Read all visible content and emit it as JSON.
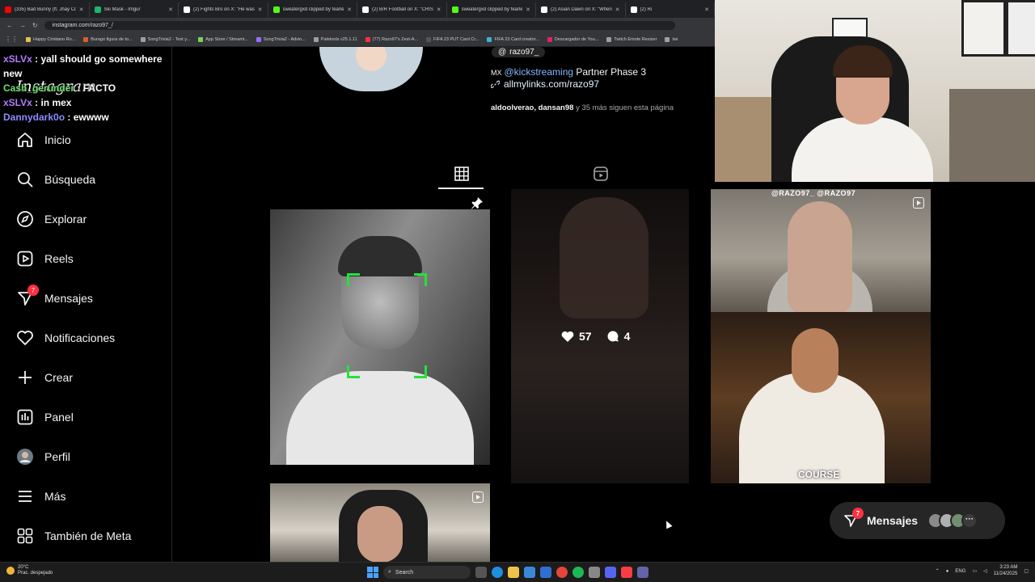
{
  "browser": {
    "tabs": [
      {
        "label": "(335) Bad Bunny (ft. Jhay Corte",
        "color": "#ff0000"
      },
      {
        "label": "Ski Mask - Imgur",
        "color": "#1bb76e"
      },
      {
        "label": "(2) Fights Bro on X: \"He was fe",
        "color": "#ffffff"
      },
      {
        "label": "sweatergxd clipped by fearless",
        "color": "#53fc18"
      },
      {
        "label": "(2) B/R Football on X: \"CRISTIA",
        "color": "#ffffff"
      },
      {
        "label": "sweatergxd clipped by fearless",
        "color": "#53fc18"
      },
      {
        "label": "(2) Asian Dawn on X: \"When yo",
        "color": "#ffffff"
      },
      {
        "label": "(2) Ri",
        "color": "#ffffff"
      }
    ],
    "url": "instagram.com/razo97_/",
    "bookmarks": [
      {
        "label": "Happy Cristiano Ro...",
        "color": "#e8c24a"
      },
      {
        "label": "Burago figura de to...",
        "color": "#e05a2b"
      },
      {
        "label": "SongTrivia2 - Test y...",
        "color": "#9aa0a6"
      },
      {
        "label": "App Store / Streami...",
        "color": "#7ad35a"
      },
      {
        "label": "SongTrivia2 - Advin...",
        "color": "#9b6bff"
      },
      {
        "label": "Paletools v25.1.11",
        "color": "#9aa0a6"
      },
      {
        "label": "(77) Razo97's Zest-A...",
        "color": "#ff3040"
      },
      {
        "label": "FIFA 23 PUT Card Cr...",
        "color": "#555"
      },
      {
        "label": "FIFA 23 Card creator...",
        "color": "#3fb0d9"
      },
      {
        "label": "Descargador de You...",
        "color": "#e0245e"
      },
      {
        "label": "Twitch Emote Resizer",
        "color": "#9aa0a6"
      },
      {
        "label": "twi",
        "color": "#9aa0a6"
      }
    ]
  },
  "chat": [
    {
      "user": "xSLVx",
      "text": " : yall should go somewhere new",
      "cls": "u1"
    },
    {
      "user": "Cash_gerunder",
      "text": " : FACTO",
      "cls": "u2"
    },
    {
      "user": "xSLVx",
      "text": " : in mex",
      "cls": "u1"
    },
    {
      "user": "Dannydark0o",
      "text": " : ewwww",
      "cls": "u3"
    }
  ],
  "sidebar": {
    "logo": "Instagram",
    "items": [
      {
        "label": "Inicio",
        "icon": "home-icon"
      },
      {
        "label": "Búsqueda",
        "icon": "search-icon"
      },
      {
        "label": "Explorar",
        "icon": "compass-icon"
      },
      {
        "label": "Reels",
        "icon": "reels-icon"
      },
      {
        "label": "Mensajes",
        "icon": "messenger-icon",
        "badge": "7"
      },
      {
        "label": "Notificaciones",
        "icon": "heart-icon"
      },
      {
        "label": "Crear",
        "icon": "plus-icon"
      },
      {
        "label": "Panel",
        "icon": "dashboard-icon"
      },
      {
        "label": "Perfil",
        "icon": "avatar-icon"
      },
      {
        "label": "Más",
        "icon": "menu-icon"
      },
      {
        "label": "También de Meta",
        "icon": "meta-icon"
      }
    ]
  },
  "profile": {
    "threads_handle": "razo97_",
    "bio_country": "MX",
    "bio_tag": "@kickstreaming",
    "bio_rest": " Partner Phase 3",
    "link": "allmylinks.com/razo97",
    "followed_by_names": "aldoolverao, dansan98",
    "followed_by_rest": " y 35 más siguen esta página"
  },
  "posts": {
    "hover_likes": "57",
    "hover_comments": "4",
    "post3_overlay": "@RAZO97_ @RAZO97",
    "post4_caption": "COURSE"
  },
  "messages_pill": {
    "label": "Mensajes",
    "badge": "7"
  },
  "taskbar": {
    "weather_temp": "20°C",
    "weather_desc": "Prac. despejado",
    "search": "Search",
    "lang": "ENG",
    "time": "3:23 AM",
    "date": "11/24/2025"
  }
}
